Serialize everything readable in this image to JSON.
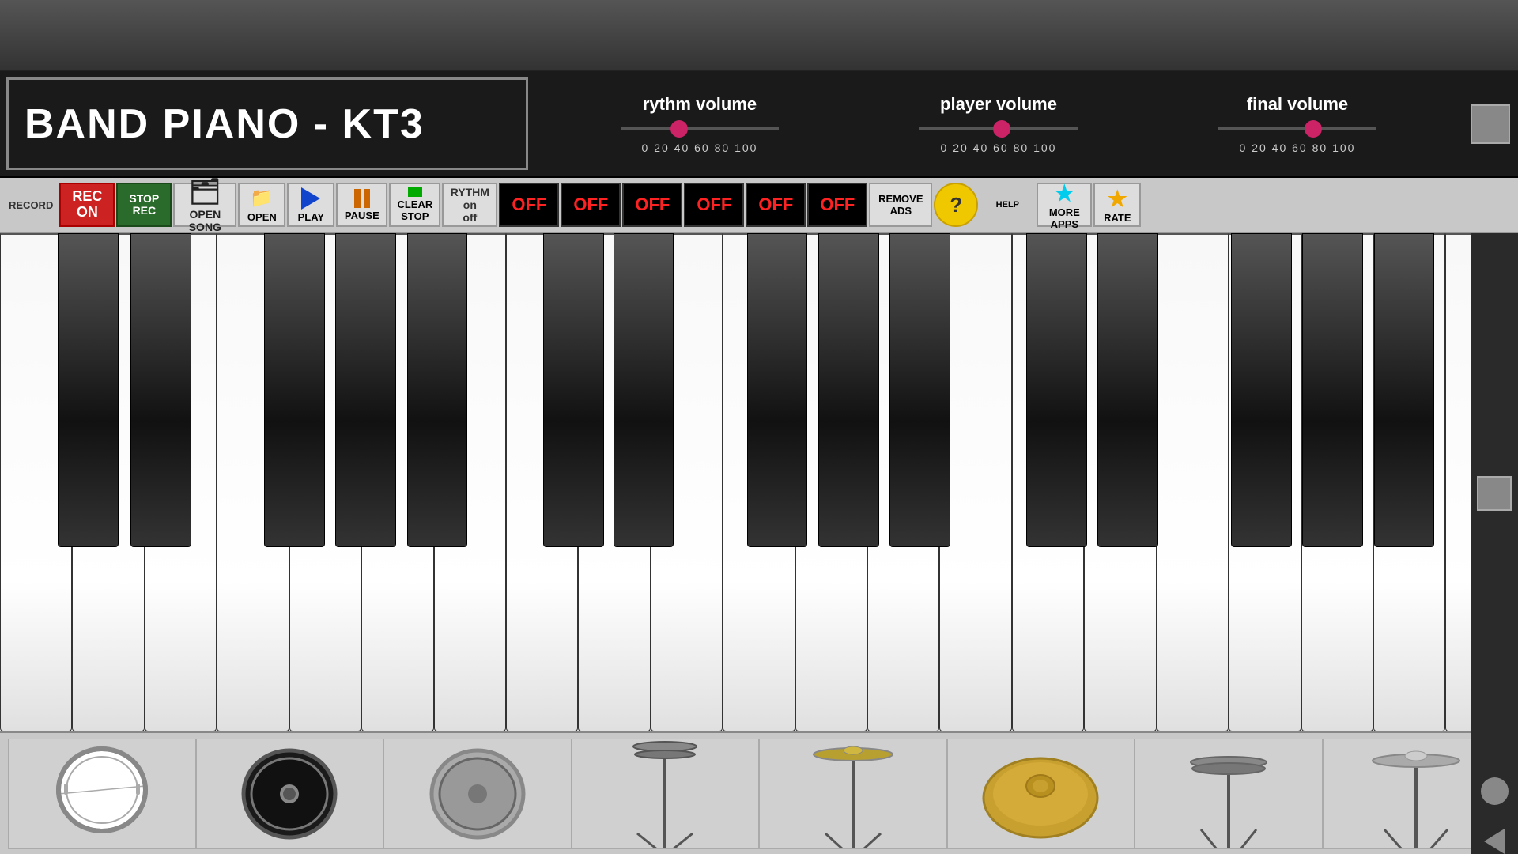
{
  "app": {
    "title": "BAND PIANO - KT3"
  },
  "volumes": {
    "rythm": {
      "label": "rythm volume",
      "value": 37,
      "scale": "0  20  40  60  80  100"
    },
    "player": {
      "label": "player volume",
      "value": 52,
      "scale": "0  20  40  60  80  100"
    },
    "final": {
      "label": "final volume",
      "value": 60,
      "scale": "0  20  40  60  80  100"
    }
  },
  "toolbar": {
    "record_label": "RECORD",
    "rec_on_line1": "REC",
    "rec_on_line2": "ON",
    "stop_rec_line1": "STOP",
    "stop_rec_line2": "REC",
    "open_song_line1": "OPEN",
    "open_song_line2": "SONG",
    "open_label": "OPEN",
    "play_label": "PLAY",
    "pause_label": "PAUSE",
    "clear_label": "CLEAR",
    "stop_label": "STOP",
    "rythm_line1": "RYTHM",
    "rythm_line2": "on",
    "rythm_line3": "off",
    "off_buttons": [
      "OFF",
      "OFF",
      "OFF",
      "OFF",
      "OFF",
      "OFF"
    ],
    "remove_ads_line1": "REMOVE",
    "remove_ads_line2": "ADS",
    "help_label": "HELP",
    "more_apps_line1": "MORE",
    "more_apps_line2": "APPS",
    "rate_label": "RATE"
  },
  "drums": [
    {
      "name": "snare-drum",
      "label": "Snare"
    },
    {
      "name": "bass-drum-dark",
      "label": "Bass Dark"
    },
    {
      "name": "bass-drum",
      "label": "Bass"
    },
    {
      "name": "hi-hat-stand",
      "label": "Hi-Hat Stand"
    },
    {
      "name": "cymbal-stand",
      "label": "Cymbal Stand"
    },
    {
      "name": "cymbal",
      "label": "Cymbal"
    },
    {
      "name": "hi-hat",
      "label": "Hi-Hat"
    },
    {
      "name": "ride-cymbal",
      "label": "Ride"
    }
  ]
}
